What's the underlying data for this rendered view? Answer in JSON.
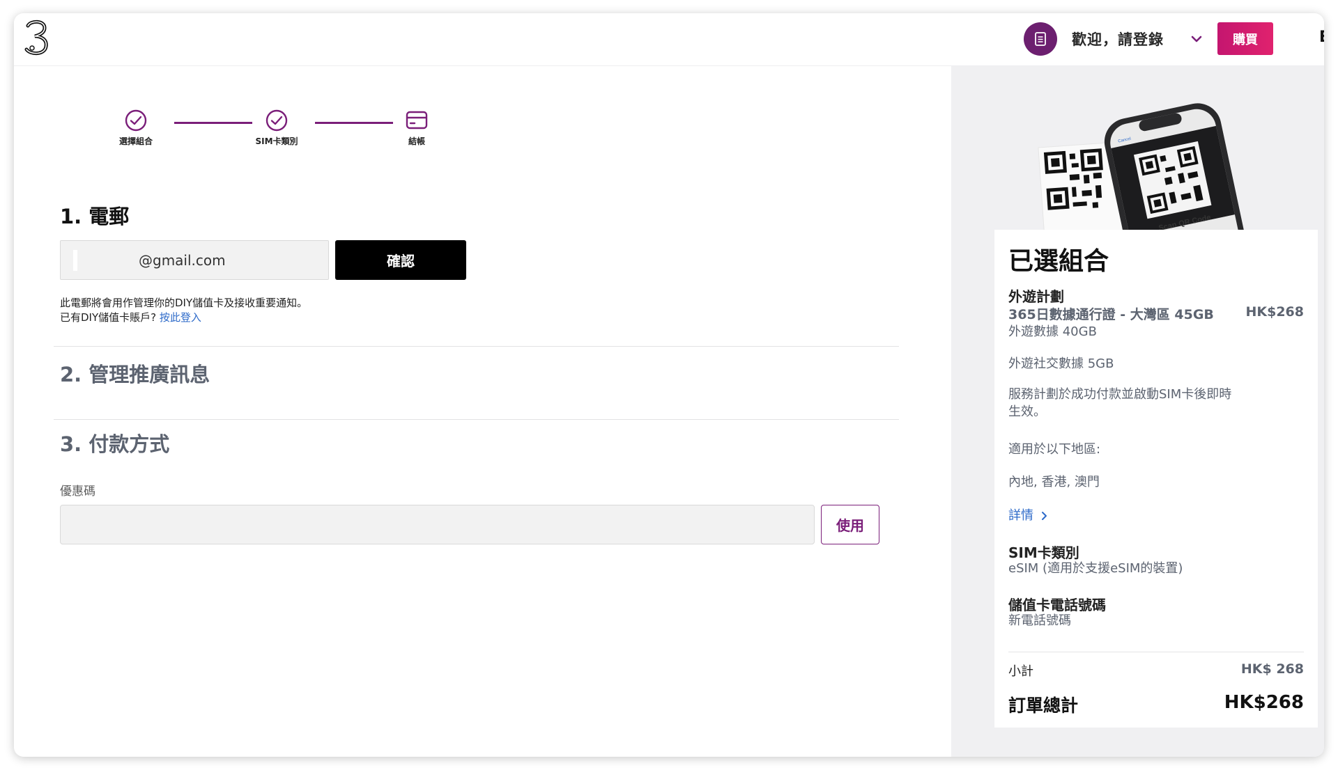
{
  "brand": {
    "logo": "3",
    "accent": "#7a1e79",
    "buy_gradient": [
      "#c4166f",
      "#e0226e"
    ]
  },
  "header": {
    "welcome": "歡迎，請登錄",
    "buy_label": "購買",
    "lang_label": "E"
  },
  "stepper": {
    "steps": [
      {
        "label": "選擇組合",
        "state": "done",
        "icon": "check-circle-icon"
      },
      {
        "label": "SIM卡類別",
        "state": "done",
        "icon": "check-circle-icon"
      },
      {
        "label": "結帳",
        "state": "current",
        "icon": "credit-card-icon"
      }
    ]
  },
  "email_section": {
    "title": "1. 電郵",
    "email_value": "@gmail.com",
    "confirm_label": "確認",
    "notice_line1": "此電郵將會用作管理你的DIY儲值卡及接收重要通知。",
    "notice_line2": "已有DIY儲值卡賬戶?",
    "login_link": "按此登入"
  },
  "promo_section": {
    "title": "2. 管理推廣訊息"
  },
  "payment_section": {
    "title": "3. 付款方式",
    "promo_label": "優惠碼",
    "promo_value": "",
    "apply_label": "使用"
  },
  "summary": {
    "title": "已選組合",
    "plan_heading": "外遊計劃",
    "plan_name": "365日數據通行證 - 大灣區 45GB",
    "plan_price": "HK$268",
    "data1": "外遊數據 40GB",
    "data2": "外遊社交數據 5GB",
    "activation_line1": "服務計劃於成功付款並啟動SIM卡後即時",
    "activation_line2": "生效。",
    "regions_label": "適用於以下地區:",
    "regions": "內地, 香港, 澳門",
    "details_link": "詳情",
    "sim_heading": "SIM卡類別",
    "sim_value": "eSIM (適用於支援eSIM的裝置)",
    "number_heading": "儲值卡電話號碼",
    "number_value": "新電話號碼",
    "subtotal_label": "小計",
    "subtotal_value": "HK$ 268",
    "total_label": "訂單總計",
    "total_value": "HK$268",
    "phone_caption": "Scan QR Code",
    "phone_cancel": "Cancel"
  }
}
